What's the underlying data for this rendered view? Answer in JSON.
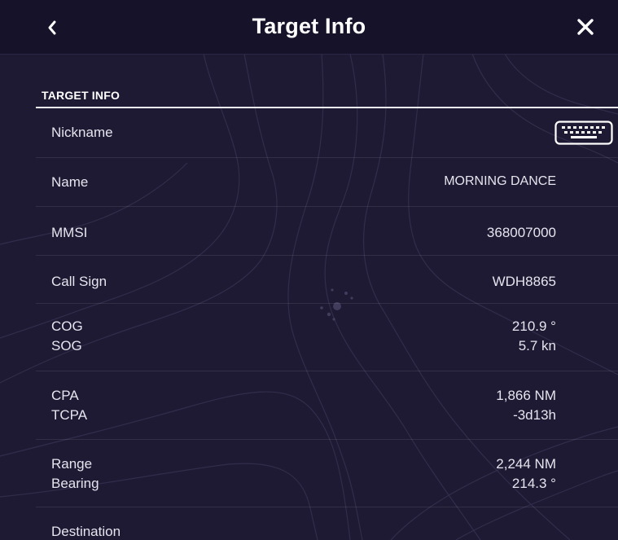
{
  "header": {
    "title": "Target Info",
    "back_icon": "chevron-left-icon",
    "close_icon": "close-icon"
  },
  "section": {
    "title": "TARGET INFO"
  },
  "rows": {
    "nickname": {
      "label": "Nickname",
      "action_icon": "keyboard-icon"
    },
    "name": {
      "label": "Name",
      "value": "MORNING DANCE"
    },
    "mmsi": {
      "label": "MMSI",
      "value": "368007000"
    },
    "call_sign": {
      "label": "Call Sign",
      "value": "WDH8865"
    },
    "cog": {
      "label": "COG",
      "value": "210.9 °"
    },
    "sog": {
      "label": "SOG",
      "value": "5.7 kn"
    },
    "cpa": {
      "label": "CPA",
      "value": "1,866 NM"
    },
    "tcpa": {
      "label": "TCPA",
      "value": "-3d13h"
    },
    "range": {
      "label": "Range",
      "value": "2,244 NM"
    },
    "bearing": {
      "label": "Bearing",
      "value": "214.3 °"
    },
    "destination": {
      "label": "Destination"
    }
  },
  "colors": {
    "background": "#1e1a33",
    "titlebar": "#15122a",
    "text": "#e6e4ee",
    "section_rule": "#f2f2f5"
  }
}
